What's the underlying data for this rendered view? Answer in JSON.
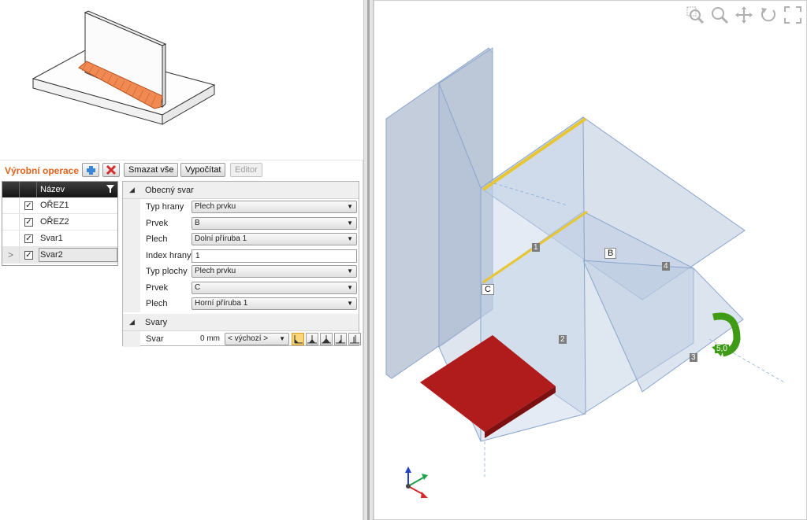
{
  "operations": {
    "title": "Výrobní operace",
    "add_icon": "plus-icon",
    "delete_icon": "delete-x-icon",
    "buttons": {
      "delete_all": "Smazat vše",
      "calculate": "Vypočítat",
      "editor": "Editor"
    },
    "list": {
      "column_name": "Název",
      "filter_icon": "filter-icon",
      "rows": [
        {
          "name": "OŘEZ1",
          "checked": true,
          "selected": false
        },
        {
          "name": "OŘEZ2",
          "checked": true,
          "selected": false
        },
        {
          "name": "Svar1",
          "checked": true,
          "selected": false
        },
        {
          "name": "Svar2",
          "checked": true,
          "selected": true,
          "indicator": ">"
        }
      ]
    }
  },
  "properties": {
    "section_general": "Obecný svar",
    "edge_type_label": "Typ hrany",
    "edge_type_value": "Plech prvku",
    "member_label": "Prvek",
    "member_value": "B",
    "plate_label": "Plech",
    "plate_value": "Dolní příruba 1",
    "edge_index_label": "Index hrany",
    "edge_index_value": "1",
    "surface_type_label": "Typ plochy",
    "surface_type_value": "Plech prvku",
    "member2_label": "Prvek",
    "member2_value": "C",
    "plate2_label": "Plech",
    "plate2_value": "Horní příruba 1",
    "section_welds": "Svary",
    "weld_label": "Svar",
    "weld_size": "0 mm",
    "weld_type": "< výchozí >"
  },
  "viewport": {
    "labels": {
      "member_b": "B",
      "member_c": "C",
      "edge_1": "1",
      "edge_2": "2",
      "edge_3": "3",
      "edge_4": "4",
      "rotation_value": "5,0"
    },
    "tools": [
      "zoom-window-icon",
      "zoom-icon",
      "pan-icon",
      "rotate-icon",
      "fit-extents-icon"
    ]
  },
  "colors": {
    "accent_orange": "#e2621b",
    "steel_blue": "#b9c9df",
    "cut_red": "#b01b1b",
    "weld_yellow": "#e7c632",
    "rotation_green": "#3f9b16"
  }
}
